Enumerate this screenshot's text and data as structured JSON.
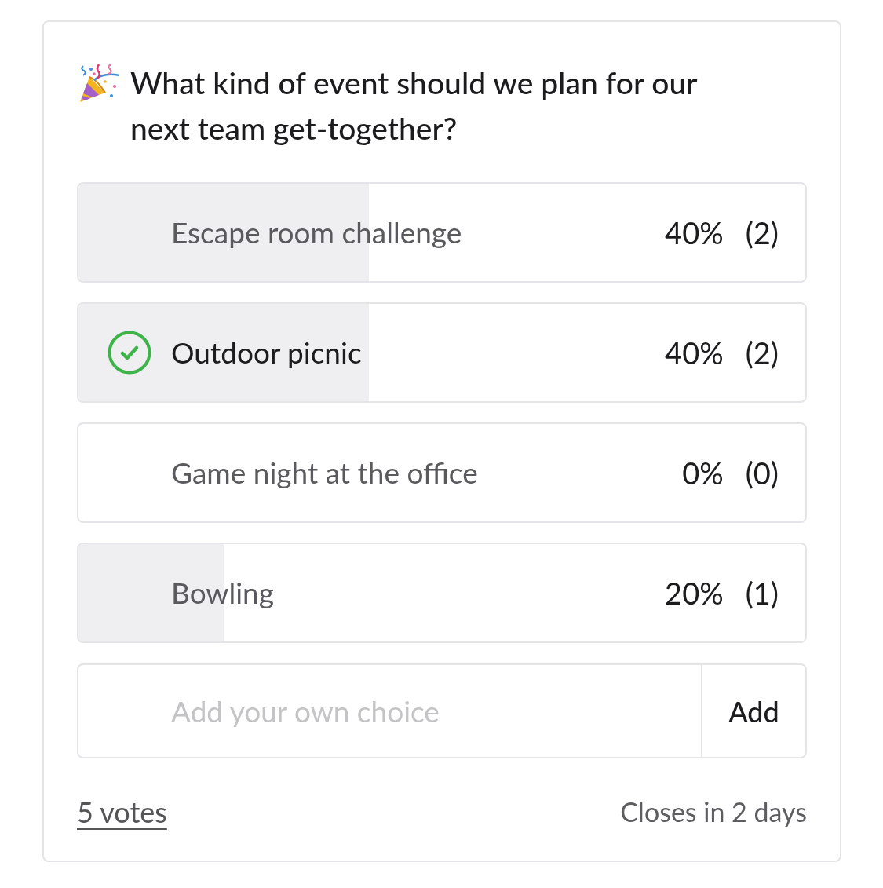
{
  "question": "What kind of event should we plan for our next team get-together?",
  "options": [
    {
      "label": "Escape room challenge",
      "level": 0.4,
      "percent": "40%",
      "count": "(2)",
      "selected": false
    },
    {
      "label": "Outdoor picnic",
      "level": 0.4,
      "percent": "40%",
      "count": "(2)",
      "selected": true
    },
    {
      "label": "Game night at the office",
      "percent": "0%",
      "count": "(0)",
      "selected": false
    },
    {
      "label": "Bowling",
      "level": 0.2,
      "percent": "20%",
      "count": "(1)",
      "selected": false
    }
  ],
  "add_choice": {
    "placeholder": "Add your own choice",
    "button": "Add"
  },
  "footer": {
    "votes": "5 votes",
    "closes": "Closes in 2 days"
  }
}
